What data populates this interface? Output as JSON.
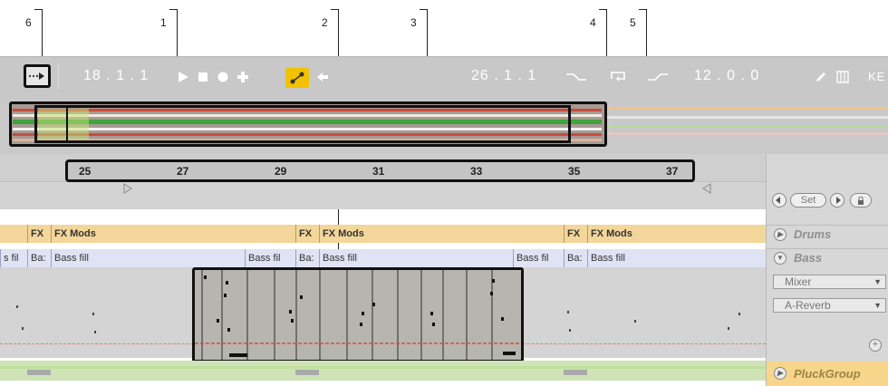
{
  "callouts": [
    "6",
    "1",
    "2",
    "3",
    "4",
    "5"
  ],
  "transport": {
    "song_position": "18 .  1 .  1",
    "loop_start": "26 .  1 .  1",
    "loop_length": "12 .  0 .  0",
    "key_label": "KE"
  },
  "ruler": {
    "beats": [
      "25",
      "27",
      "29",
      "31",
      "33",
      "35",
      "37"
    ]
  },
  "locators": {
    "set_label": "Set"
  },
  "clips": {
    "fx_short": "FX",
    "fx_mods": "FX Mods",
    "bass_fill": "Bass fill",
    "bass_fill_cut": "Bass fil",
    "bass_cut": "Ba:",
    "s_fill_cut": "s fil"
  },
  "tracks": {
    "drums": "Drums",
    "bass": "Bass",
    "pluck_group": "PluckGroup"
  },
  "device_chooser": {
    "mixer": "Mixer",
    "reverb": "A-Reverb"
  },
  "colors": {
    "accent_yellow": "#f2c200",
    "fx_clip": "#f3d69a",
    "bass_clip": "#e0e3f3",
    "midi_note": "#1a1a1a",
    "loop_marker": "#e04a3c",
    "overview_green": "#3ea53a"
  }
}
